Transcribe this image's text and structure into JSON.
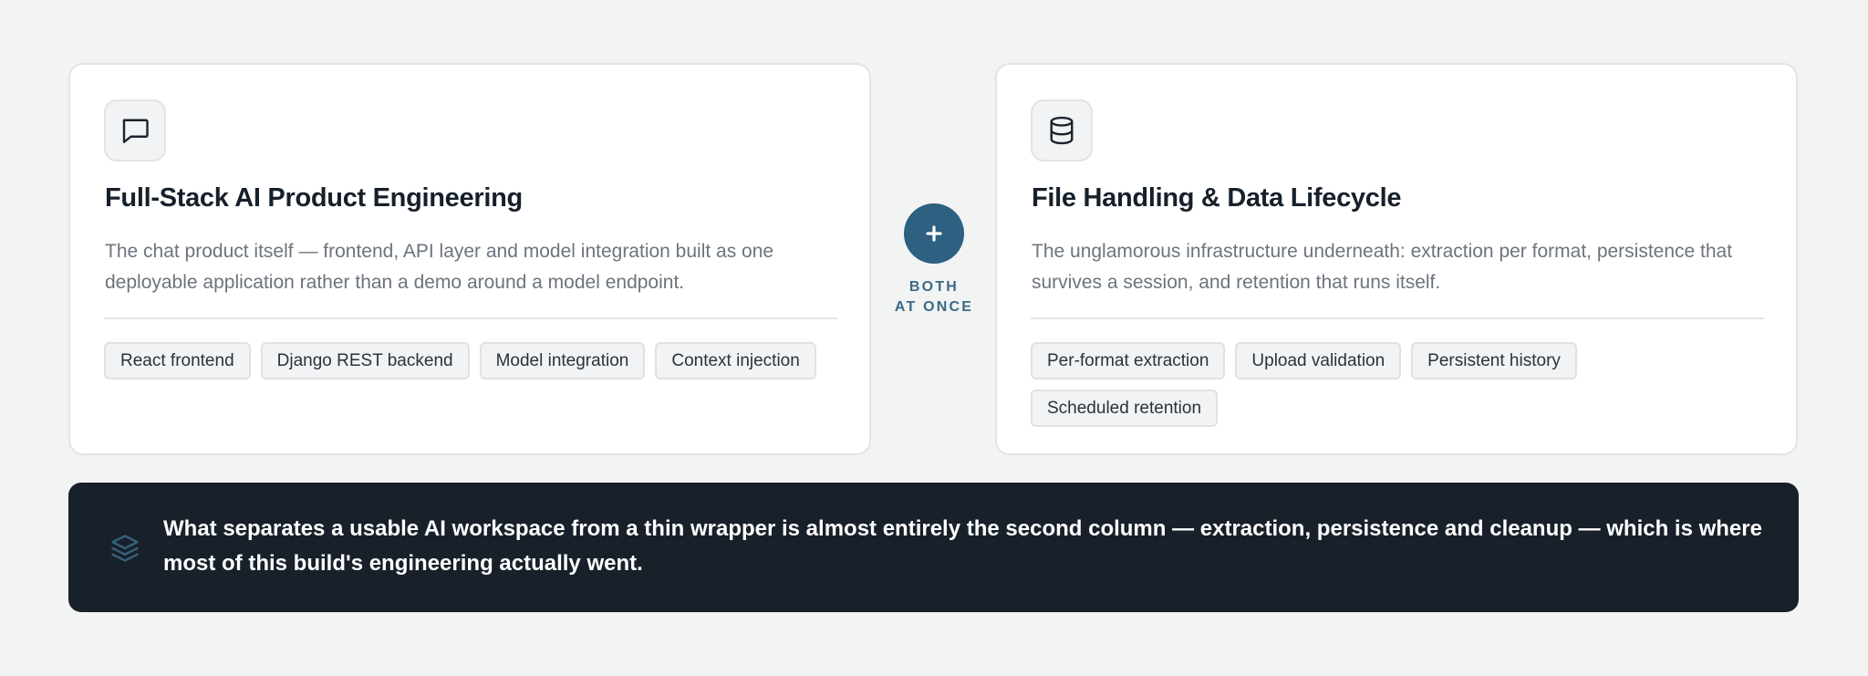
{
  "cards": [
    {
      "icon": "chat-bubble-icon",
      "title": "Full-Stack AI Product Engineering",
      "description": "The chat product itself — frontend, API layer and model integration built as one deployable application rather than a demo around a model endpoint.",
      "tags": [
        "React frontend",
        "Django REST backend",
        "Model integration",
        "Context injection"
      ]
    },
    {
      "icon": "database-icon",
      "title": "File Handling & Data Lifecycle",
      "description": "The unglamorous infrastructure underneath: extraction per format, persistence that survives a session, and retention that runs itself.",
      "tags": [
        "Per-format extraction",
        "Upload validation",
        "Persistent history",
        "Scheduled retention"
      ]
    }
  ],
  "connector": {
    "symbol": "+",
    "label_line1": "BOTH",
    "label_line2": "AT ONCE"
  },
  "banner": {
    "icon": "layers-icon",
    "text": "What separates a usable AI workspace from a thin wrapper is almost entirely the second column — extraction, persistence and cleanup — which is where most of this build's engineering actually went."
  },
  "colors": {
    "background": "#f2f3f3",
    "card": "#ffffff",
    "accent": "#2d6081",
    "banner": "#18202a",
    "title": "#16202b",
    "muted_text": "#6c747d"
  }
}
